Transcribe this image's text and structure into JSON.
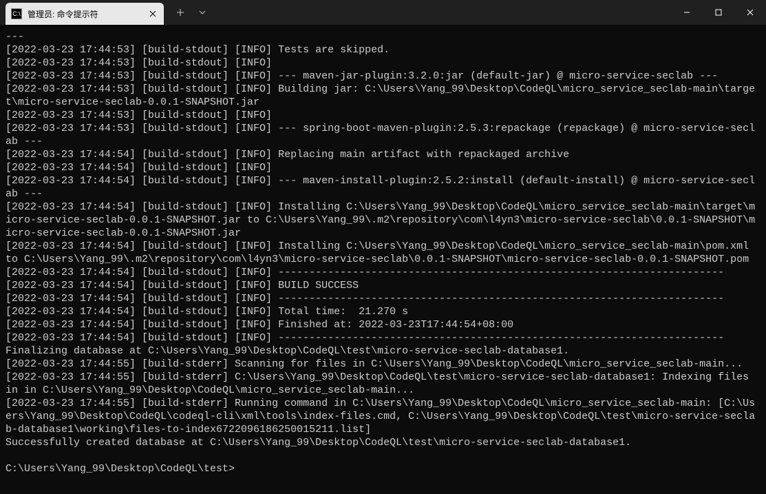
{
  "window": {
    "tab_title": "管理员: 命令提示符",
    "tab_icon_text": "C:\\"
  },
  "terminal": {
    "lines": [
      "---",
      "[2022-03-23 17:44:53] [build-stdout] [INFO] Tests are skipped.",
      "[2022-03-23 17:44:53] [build-stdout] [INFO]",
      "[2022-03-23 17:44:53] [build-stdout] [INFO] --- maven-jar-plugin:3.2.0:jar (default-jar) @ micro-service-seclab ---",
      "[2022-03-23 17:44:53] [build-stdout] [INFO] Building jar: C:\\Users\\Yang_99\\Desktop\\CodeQL\\micro_service_seclab-main\\target\\micro-service-seclab-0.0.1-SNAPSHOT.jar",
      "[2022-03-23 17:44:53] [build-stdout] [INFO]",
      "[2022-03-23 17:44:53] [build-stdout] [INFO] --- spring-boot-maven-plugin:2.5.3:repackage (repackage) @ micro-service-seclab ---",
      "[2022-03-23 17:44:54] [build-stdout] [INFO] Replacing main artifact with repackaged archive",
      "[2022-03-23 17:44:54] [build-stdout] [INFO]",
      "[2022-03-23 17:44:54] [build-stdout] [INFO] --- maven-install-plugin:2.5.2:install (default-install) @ micro-service-seclab ---",
      "[2022-03-23 17:44:54] [build-stdout] [INFO] Installing C:\\Users\\Yang_99\\Desktop\\CodeQL\\micro_service_seclab-main\\target\\micro-service-seclab-0.0.1-SNAPSHOT.jar to C:\\Users\\Yang_99\\.m2\\repository\\com\\l4yn3\\micro-service-seclab\\0.0.1-SNAPSHOT\\micro-service-seclab-0.0.1-SNAPSHOT.jar",
      "[2022-03-23 17:44:54] [build-stdout] [INFO] Installing C:\\Users\\Yang_99\\Desktop\\CodeQL\\micro_service_seclab-main\\pom.xml to C:\\Users\\Yang_99\\.m2\\repository\\com\\l4yn3\\micro-service-seclab\\0.0.1-SNAPSHOT\\micro-service-seclab-0.0.1-SNAPSHOT.pom",
      "[2022-03-23 17:44:54] [build-stdout] [INFO] ------------------------------------------------------------------------",
      "[2022-03-23 17:44:54] [build-stdout] [INFO] BUILD SUCCESS",
      "[2022-03-23 17:44:54] [build-stdout] [INFO] ------------------------------------------------------------------------",
      "[2022-03-23 17:44:54] [build-stdout] [INFO] Total time:  21.270 s",
      "[2022-03-23 17:44:54] [build-stdout] [INFO] Finished at: 2022-03-23T17:44:54+08:00",
      "[2022-03-23 17:44:54] [build-stdout] [INFO] ------------------------------------------------------------------------",
      "Finalizing database at C:\\Users\\Yang_99\\Desktop\\CodeQL\\test\\micro-service-seclab-database1.",
      "[2022-03-23 17:44:55] [build-stderr] Scanning for files in C:\\Users\\Yang_99\\Desktop\\CodeQL\\micro_service_seclab-main...",
      "[2022-03-23 17:44:55] [build-stderr] C:\\Users\\Yang_99\\Desktop\\CodeQL\\test\\micro-service-seclab-database1: Indexing files in in C:\\Users\\Yang_99\\Desktop\\CodeQL\\micro_service_seclab-main...",
      "[2022-03-23 17:44:55] [build-stderr] Running command in C:\\Users\\Yang_99\\Desktop\\CodeQL\\micro_service_seclab-main: [C:\\Users\\Yang_99\\Desktop\\CodeQL\\codeql-cli\\xml\\tools\\index-files.cmd, C:\\Users\\Yang_99\\Desktop\\CodeQL\\test\\micro-service-seclab-database1\\working\\files-to-index6722096186250015211.list]",
      "Successfully created database at C:\\Users\\Yang_99\\Desktop\\CodeQL\\test\\micro-service-seclab-database1."
    ],
    "prompt": "C:\\Users\\Yang_99\\Desktop\\CodeQL\\test>"
  }
}
